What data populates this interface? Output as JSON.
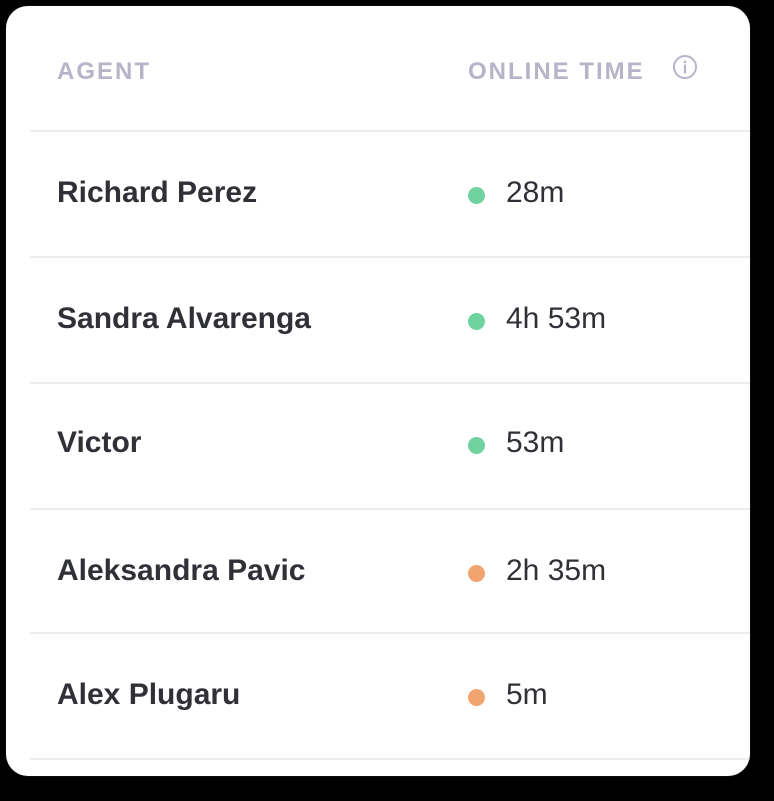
{
  "table": {
    "headers": {
      "agent": "AGENT",
      "online_time": "ONLINE TIME"
    },
    "info_icon": "info-circle-icon",
    "status_colors": {
      "online": "#6fd3a0",
      "away": "#f2a470"
    },
    "rows": [
      {
        "name": "Richard Perez",
        "time": "28m",
        "status": "online"
      },
      {
        "name": "Sandra Alvarenga",
        "time": "4h 53m",
        "status": "online"
      },
      {
        "name": "Victor",
        "time": "53m",
        "status": "online"
      },
      {
        "name": "Aleksandra Pavic",
        "time": "2h 35m",
        "status": "away"
      },
      {
        "name": "Alex Plugaru",
        "time": "5m",
        "status": "away"
      }
    ]
  }
}
